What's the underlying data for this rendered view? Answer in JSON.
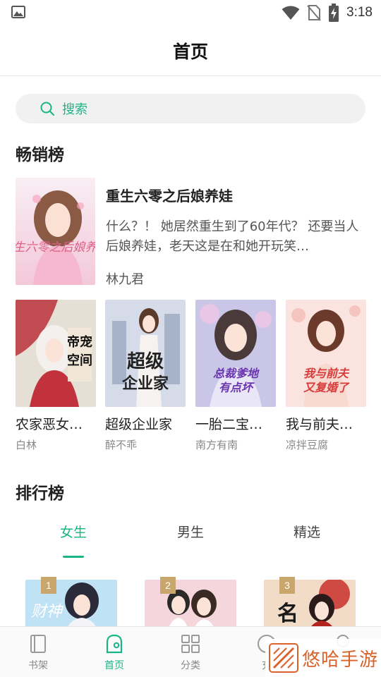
{
  "status_bar": {
    "time": "3:18"
  },
  "header": {
    "title": "首页"
  },
  "search": {
    "label": "搜索"
  },
  "bestseller": {
    "section_title": "畅销榜",
    "featured": {
      "title": "重生六零之后娘养娃",
      "description": "什么？！ 她居然重生到了60年代？ 还要当人后娘养娃，老天这是在和她开玩笑…",
      "author": "林九君",
      "cover_text": "重生六零之后娘养娃"
    },
    "books": [
      {
        "title": "农家恶女…",
        "author": "白林",
        "cover_text": "帝宠空间",
        "cover_color": "#e6dfd6"
      },
      {
        "title": "超级企业家",
        "author": "醉不乖",
        "cover_text": "超级企业家",
        "cover_color": "#d5dbe8"
      },
      {
        "title": "一胎二宝…",
        "author": "南方有南",
        "cover_text": "总裁爹地有点坏",
        "cover_color": "#c9c6e8"
      },
      {
        "title": "我与前夫…",
        "author": "凉拌豆腐",
        "cover_text": "我与前夫又复婚了",
        "cover_color": "#fbe4e0"
      }
    ]
  },
  "ranking": {
    "section_title": "排行榜",
    "tabs": [
      {
        "label": "女生",
        "active": true
      },
      {
        "label": "男生",
        "active": false
      },
      {
        "label": "精选",
        "active": false
      }
    ],
    "books": [
      {
        "rank": "1",
        "cover_text": "财神"
      },
      {
        "rank": "2",
        "cover_text": ""
      },
      {
        "rank": "3",
        "cover_text": "名"
      }
    ]
  },
  "bottom_nav": {
    "items": [
      {
        "label": "书架",
        "icon": "bookshelf-icon",
        "active": false
      },
      {
        "label": "首页",
        "icon": "home-icon",
        "active": true
      },
      {
        "label": "分类",
        "icon": "category-icon",
        "active": false
      },
      {
        "label": "充",
        "icon": "recharge-icon",
        "active": false
      },
      {
        "label": "",
        "icon": "profile-icon",
        "active": false
      }
    ]
  },
  "watermark": {
    "text": "悠哈手游"
  },
  "colors": {
    "accent": "#19b586",
    "rank_badge": "#c9a66b",
    "watermark": "#d9622b"
  }
}
